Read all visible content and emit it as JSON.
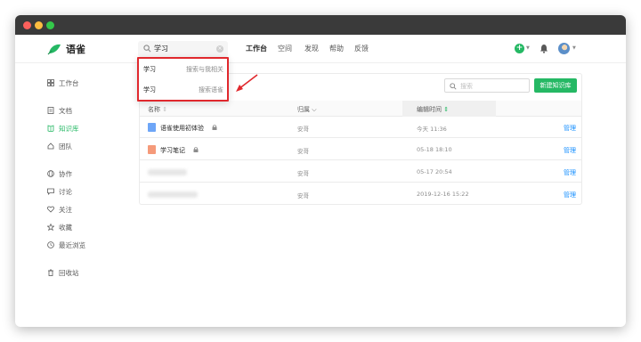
{
  "app": {
    "brand": "语雀"
  },
  "topnav": {
    "search_value": "学习",
    "links": [
      "工作台",
      "空间",
      "发现",
      "帮助",
      "反馈"
    ]
  },
  "search_dropdown": {
    "items": [
      {
        "query": "学习",
        "desc": "搜索与我相关"
      },
      {
        "query": "学习",
        "desc": "搜索语雀"
      }
    ]
  },
  "sidebar": {
    "items": [
      {
        "label": "工作台",
        "icon": "grid-icon"
      },
      {
        "label": "文档",
        "icon": "document-icon"
      },
      {
        "label": "知识库",
        "icon": "book-icon",
        "active": true
      },
      {
        "label": "团队",
        "icon": "team-icon"
      },
      {
        "label": "协作",
        "icon": "globe-icon"
      },
      {
        "label": "讨论",
        "icon": "comment-icon"
      },
      {
        "label": "关注",
        "icon": "heart-icon"
      },
      {
        "label": "收藏",
        "icon": "star-icon"
      },
      {
        "label": "最近浏览",
        "icon": "clock-icon"
      },
      {
        "label": "回收站",
        "icon": "trash-icon"
      }
    ]
  },
  "panel": {
    "search_placeholder": "搜索",
    "new_button": "新建知识库",
    "columns": {
      "name": "名称",
      "owner": "归属",
      "edited": "编辑时间"
    },
    "rows": [
      {
        "name": "语雀使用初体验",
        "owner": "安哥",
        "time": "今天 11:36",
        "action": "管理"
      },
      {
        "name": "学习笔记",
        "owner": "安哥",
        "time": "05-18 18:10",
        "action": "管理"
      },
      {
        "name": "",
        "owner": "安哥",
        "time": "05-17 20:54",
        "action": "管理"
      },
      {
        "name": "",
        "owner": "安哥",
        "time": "2019-12-16 15:22",
        "action": "管理"
      }
    ]
  },
  "colors": {
    "accent": "#25b864",
    "highlight": "#e0282d",
    "link": "#1890ff"
  }
}
